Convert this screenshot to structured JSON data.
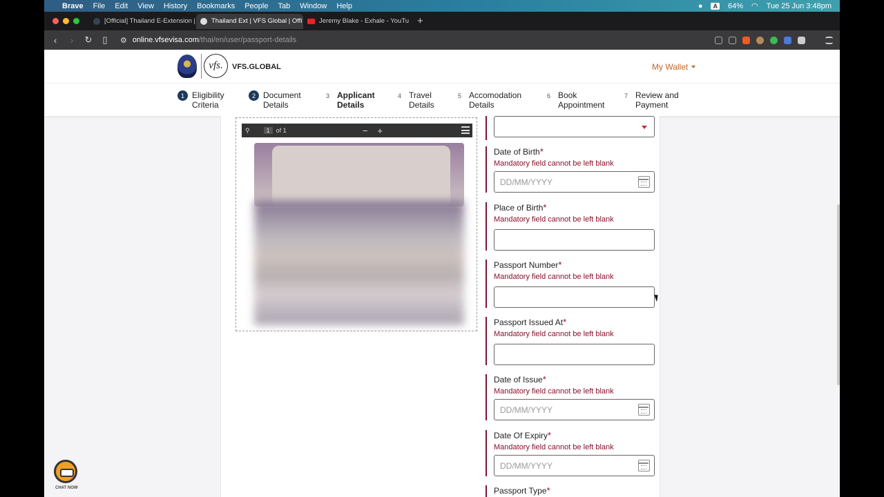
{
  "menubar": {
    "app": "Brave",
    "items": [
      "File",
      "Edit",
      "View",
      "History",
      "Bookmarks",
      "People",
      "Tab",
      "Window",
      "Help"
    ],
    "battery": "64%",
    "datetime": "Tue 25 Jun  3:48pm",
    "input_badge": "A"
  },
  "tabs": [
    {
      "title": "[Official] Thailand E-Extension | T"
    },
    {
      "title": "Thailand Ext | VFS Global | Offi"
    },
    {
      "title": "Jeremy Blake - Exhale - YouTu"
    }
  ],
  "address": {
    "host": "online.vfsevisa.com",
    "path": "/thai/en/user/passport-details"
  },
  "header": {
    "brand": "VFS.GLOBAL",
    "logo_mark": "vfs.",
    "wallet": "My Wallet"
  },
  "steps": [
    {
      "num": "1",
      "label": "Eligibility\nCriteria"
    },
    {
      "num": "2",
      "label": "Document\nDetails"
    },
    {
      "num": "3",
      "label": "Applicant\nDetails"
    },
    {
      "num": "4",
      "label": "Travel\nDetails"
    },
    {
      "num": "5",
      "label": "Accomodation\nDetails"
    },
    {
      "num": "6",
      "label": "Book\nAppointment"
    },
    {
      "num": "7",
      "label": "Review and\nPayment"
    }
  ],
  "viewer": {
    "page": "1",
    "of": "of 1",
    "zoom_out": "−",
    "zoom_in": "+"
  },
  "form": {
    "required_mark": "*",
    "error": "Mandatory field cannot be left blank",
    "date_placeholder": "DD/MM/YYYY",
    "dob_label": "Date of Birth",
    "pob_label": "Place of Birth",
    "passport_number_label": "Passport Number",
    "issued_at_label": "Passport Issued At",
    "date_issue_label": "Date of Issue",
    "date_expiry_label": "Date Of Expiry",
    "passport_type_label": "Passport Type"
  },
  "chat": {
    "label": "CHAT NOW"
  }
}
